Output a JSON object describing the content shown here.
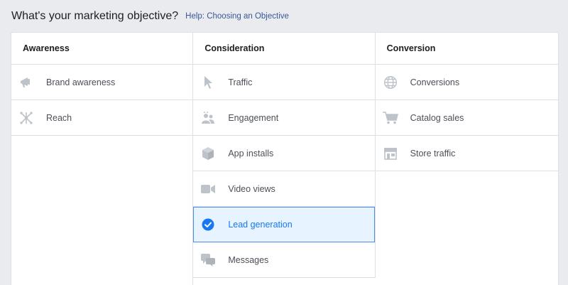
{
  "header": {
    "title": "What's your marketing objective?",
    "help_link": "Help: Choosing an Objective"
  },
  "columns": [
    {
      "heading": "Awareness",
      "items": [
        {
          "label": "Brand awareness",
          "icon": "megaphone-icon"
        },
        {
          "label": "Reach",
          "icon": "reach-icon"
        }
      ]
    },
    {
      "heading": "Consideration",
      "items": [
        {
          "label": "Traffic",
          "icon": "cursor-icon"
        },
        {
          "label": "Engagement",
          "icon": "people-icon"
        },
        {
          "label": "App installs",
          "icon": "box-icon"
        },
        {
          "label": "Video views",
          "icon": "video-camera-icon"
        },
        {
          "label": "Lead generation",
          "icon": "check-circle-icon",
          "selected": true
        },
        {
          "label": "Messages",
          "icon": "chat-bubbles-icon"
        }
      ]
    },
    {
      "heading": "Conversion",
      "items": [
        {
          "label": "Conversions",
          "icon": "globe-icon"
        },
        {
          "label": "Catalog sales",
          "icon": "shopping-cart-icon"
        },
        {
          "label": "Store traffic",
          "icon": "storefront-icon"
        }
      ]
    }
  ],
  "colors": {
    "icon_gray": "#bec3c9",
    "selected_blue": "#1877f2",
    "selected_bg": "#e7f3ff",
    "link": "#385898"
  }
}
